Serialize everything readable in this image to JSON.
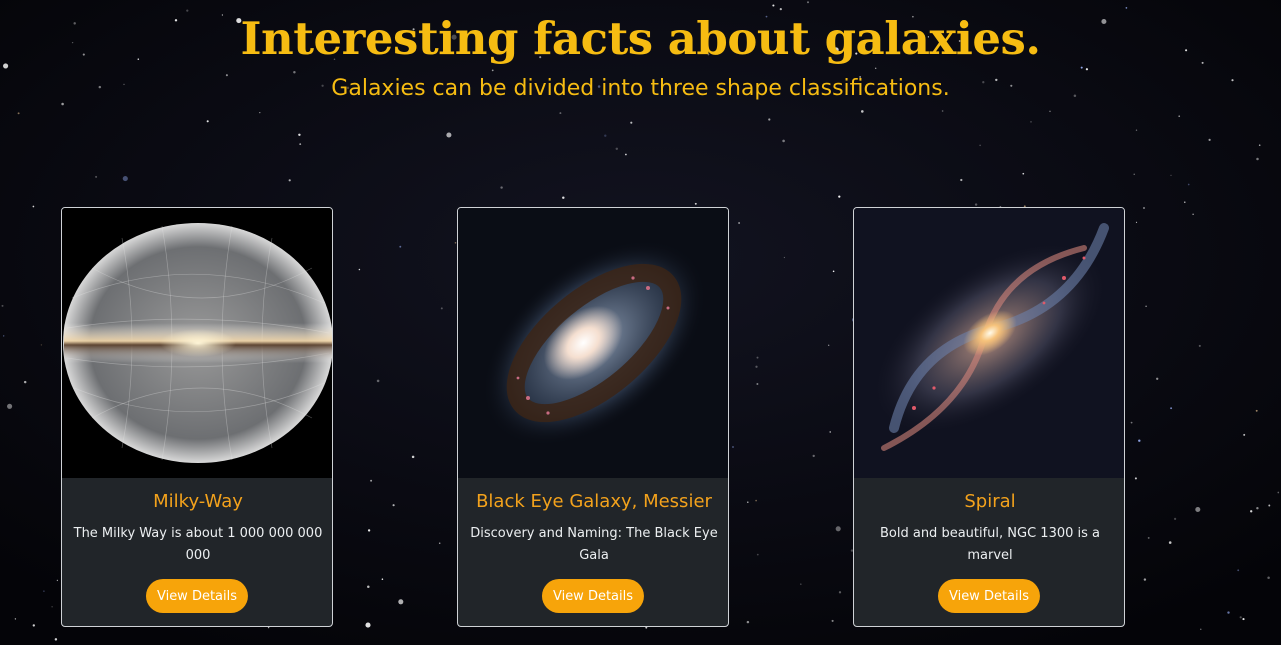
{
  "header": {
    "title": "Interesting facts about galaxies.",
    "subtitle": "Galaxies can be divided into three shape classifications."
  },
  "cards": [
    {
      "title": "Milky-Way",
      "text": "The Milky Way is about 1 000 000 000 000",
      "button_label": "View Details"
    },
    {
      "title": "Black Eye Galaxy, Messier",
      "text": "Discovery and Naming: The Black Eye Gala",
      "button_label": "View Details"
    },
    {
      "title": "Spiral",
      "text": "Bold and beautiful, NGC 1300 is a marvel",
      "button_label": "View Details"
    }
  ],
  "colors": {
    "background": "#06070b",
    "heading": "#f6bc12",
    "card_title": "#f3a21c",
    "card_bg": "#212529",
    "button": "#f7a40a"
  }
}
